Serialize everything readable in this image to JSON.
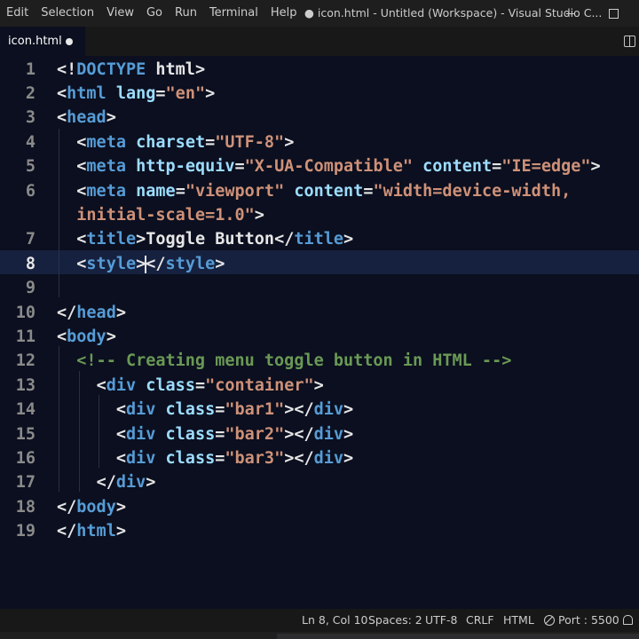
{
  "menu": [
    "Edit",
    "Selection",
    "View",
    "Go",
    "Run",
    "Terminal",
    "Help"
  ],
  "window_title": "● icon.html - Untitled (Workspace) - Visual Studio C...",
  "tab": {
    "label": "icon.html",
    "dirty": true
  },
  "icons": {
    "minimize": "minimize-icon",
    "maximize": "maximize-icon",
    "split": "split-editor-icon",
    "dirty": "unsaved-dot-icon",
    "port": "port-icon",
    "bell": "notification-bell-icon"
  },
  "editor": {
    "active_line": 8,
    "lines": [
      {
        "n": "1",
        "tokens": [
          [
            "punct",
            "<!"
          ],
          [
            "kw",
            "DOCTYPE"
          ],
          [
            "text",
            " html"
          ],
          [
            "punct",
            ">"
          ]
        ]
      },
      {
        "n": "2",
        "tokens": [
          [
            "punct",
            "<"
          ],
          [
            "tag",
            "html"
          ],
          [
            "text",
            " "
          ],
          [
            "attr",
            "lang"
          ],
          [
            "punct",
            "="
          ],
          [
            "str",
            "\"en\""
          ],
          [
            "punct",
            ">"
          ]
        ]
      },
      {
        "n": "3",
        "tokens": [
          [
            "punct",
            "<"
          ],
          [
            "tag",
            "head"
          ],
          [
            "punct",
            ">"
          ]
        ]
      },
      {
        "n": "4",
        "tokens": [
          [
            "text",
            "  "
          ],
          [
            "punct",
            "<"
          ],
          [
            "tag",
            "meta"
          ],
          [
            "text",
            " "
          ],
          [
            "attr",
            "charset"
          ],
          [
            "punct",
            "="
          ],
          [
            "str",
            "\"UTF-8\""
          ],
          [
            "punct",
            ">"
          ]
        ]
      },
      {
        "n": "5",
        "tokens": [
          [
            "text",
            "  "
          ],
          [
            "punct",
            "<"
          ],
          [
            "tag",
            "meta"
          ],
          [
            "text",
            " "
          ],
          [
            "attr",
            "http-equiv"
          ],
          [
            "punct",
            "="
          ],
          [
            "str",
            "\"X-UA-Compatible\""
          ],
          [
            "text",
            " "
          ],
          [
            "attr",
            "content"
          ],
          [
            "punct",
            "="
          ],
          [
            "str",
            "\"IE=edge\""
          ],
          [
            "punct",
            ">"
          ]
        ]
      },
      {
        "n": "6",
        "tokens": [
          [
            "text",
            "  "
          ],
          [
            "punct",
            "<"
          ],
          [
            "tag",
            "meta"
          ],
          [
            "text",
            " "
          ],
          [
            "attr",
            "name"
          ],
          [
            "punct",
            "="
          ],
          [
            "str",
            "\"viewport\""
          ],
          [
            "text",
            " "
          ],
          [
            "attr",
            "content"
          ],
          [
            "punct",
            "="
          ],
          [
            "str",
            "\"width=device-width,"
          ]
        ]
      },
      {
        "n": "",
        "tokens": [
          [
            "text",
            "  "
          ],
          [
            "str",
            "initial-scale=1.0\""
          ],
          [
            "punct",
            ">"
          ]
        ]
      },
      {
        "n": "7",
        "tokens": [
          [
            "text",
            "  "
          ],
          [
            "punct",
            "<"
          ],
          [
            "tag",
            "title"
          ],
          [
            "punct",
            ">"
          ],
          [
            "text",
            "Toggle Button"
          ],
          [
            "punct",
            "</"
          ],
          [
            "tag",
            "title"
          ],
          [
            "punct",
            ">"
          ]
        ]
      },
      {
        "n": "8",
        "tokens": [
          [
            "text",
            "  "
          ],
          [
            "punct",
            "<"
          ],
          [
            "tag",
            "style"
          ],
          [
            "punct",
            ">"
          ],
          [
            "cursor",
            ""
          ],
          [
            "punct",
            "</"
          ],
          [
            "tag",
            "style"
          ],
          [
            "punct",
            ">"
          ]
        ]
      },
      {
        "n": "9",
        "tokens": []
      },
      {
        "n": "10",
        "tokens": [
          [
            "punct",
            "</"
          ],
          [
            "tag",
            "head"
          ],
          [
            "punct",
            ">"
          ]
        ]
      },
      {
        "n": "11",
        "tokens": [
          [
            "punct",
            "<"
          ],
          [
            "tag",
            "body"
          ],
          [
            "punct",
            ">"
          ]
        ]
      },
      {
        "n": "12",
        "tokens": [
          [
            "text",
            "  "
          ],
          [
            "comment",
            "<!-- Creating menu toggle button in HTML -->"
          ]
        ]
      },
      {
        "n": "13",
        "tokens": [
          [
            "text",
            "    "
          ],
          [
            "punct",
            "<"
          ],
          [
            "tag",
            "div"
          ],
          [
            "text",
            " "
          ],
          [
            "attr",
            "class"
          ],
          [
            "punct",
            "="
          ],
          [
            "str",
            "\"container\""
          ],
          [
            "punct",
            ">"
          ]
        ]
      },
      {
        "n": "14",
        "tokens": [
          [
            "text",
            "      "
          ],
          [
            "punct",
            "<"
          ],
          [
            "tag",
            "div"
          ],
          [
            "text",
            " "
          ],
          [
            "attr",
            "class"
          ],
          [
            "punct",
            "="
          ],
          [
            "str",
            "\"bar1\""
          ],
          [
            "punct",
            "></"
          ],
          [
            "tag",
            "div"
          ],
          [
            "punct",
            ">"
          ]
        ]
      },
      {
        "n": "15",
        "tokens": [
          [
            "text",
            "      "
          ],
          [
            "punct",
            "<"
          ],
          [
            "tag",
            "div"
          ],
          [
            "text",
            " "
          ],
          [
            "attr",
            "class"
          ],
          [
            "punct",
            "="
          ],
          [
            "str",
            "\"bar2\""
          ],
          [
            "punct",
            "></"
          ],
          [
            "tag",
            "div"
          ],
          [
            "punct",
            ">"
          ]
        ]
      },
      {
        "n": "16",
        "tokens": [
          [
            "text",
            "      "
          ],
          [
            "punct",
            "<"
          ],
          [
            "tag",
            "div"
          ],
          [
            "text",
            " "
          ],
          [
            "attr",
            "class"
          ],
          [
            "punct",
            "="
          ],
          [
            "str",
            "\"bar3\""
          ],
          [
            "punct",
            "></"
          ],
          [
            "tag",
            "div"
          ],
          [
            "punct",
            ">"
          ]
        ]
      },
      {
        "n": "17",
        "tokens": [
          [
            "text",
            "    "
          ],
          [
            "punct",
            "</"
          ],
          [
            "tag",
            "div"
          ],
          [
            "punct",
            ">"
          ]
        ]
      },
      {
        "n": "18",
        "tokens": [
          [
            "punct",
            "</"
          ],
          [
            "tag",
            "body"
          ],
          [
            "punct",
            ">"
          ]
        ]
      },
      {
        "n": "19",
        "tokens": [
          [
            "punct",
            "</"
          ],
          [
            "tag",
            "html"
          ],
          [
            "punct",
            ">"
          ]
        ]
      }
    ]
  },
  "status": {
    "position": "Ln 8, Col 10",
    "spaces": "Spaces: 2",
    "encoding": "UTF-8",
    "eol": "CRLF",
    "language": "HTML",
    "port": "Port : 5500"
  },
  "colors": {
    "editor_bg": "#0b0f1f",
    "tag": "#569cd6",
    "attr": "#9cdcfe",
    "string": "#ce9178",
    "comment": "#6a9955"
  }
}
